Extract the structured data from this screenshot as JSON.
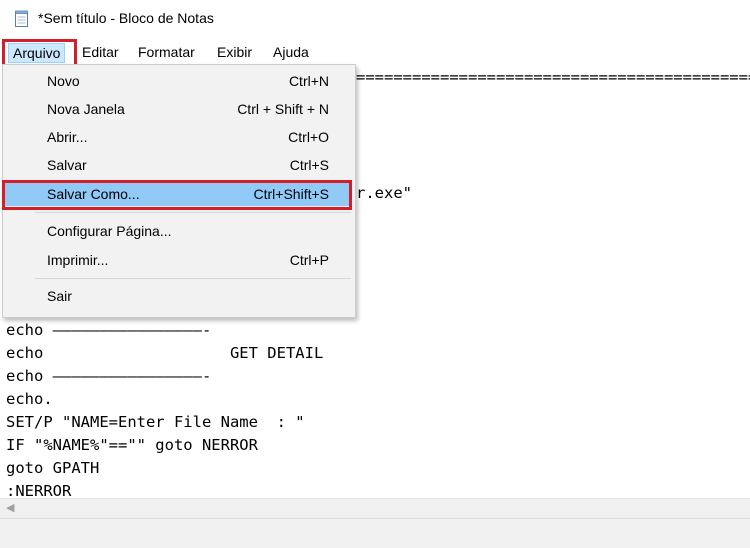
{
  "window": {
    "title": "*Sem título - Bloco de Notas"
  },
  "menubar": {
    "items": [
      "Arquivo",
      "Editar",
      "Formatar",
      "Exibir",
      "Ajuda"
    ]
  },
  "file_menu": {
    "items": [
      {
        "label": "Novo",
        "shortcut": "Ctrl+N"
      },
      {
        "label": "Nova Janela",
        "shortcut": "Ctrl + Shift + N"
      },
      {
        "label": "Abrir...",
        "shortcut": "Ctrl+O"
      },
      {
        "label": "Salvar",
        "shortcut": "Ctrl+S"
      },
      {
        "label": "Salvar Como...",
        "shortcut": "Ctrl+Shift+S"
      },
      {
        "label": "Configurar Página...",
        "shortcut": ""
      },
      {
        "label": "Imprimir...",
        "shortcut": "Ctrl+P"
      },
      {
        "label": "Sair",
        "shortcut": ""
      }
    ],
    "selected": "Salvar Como..."
  },
  "editor": {
    "lines": [
      "=============================================",
      "r.exe\"",
      "echo ————————————————-",
      "echo                    GET DETAIL",
      "echo ————————————————-",
      "echo.",
      "SET/P \"NAME=Enter File Name  : \"",
      "IF \"%NAME%\"==\"\" goto NERROR",
      "goto GPATH",
      ":NERROR"
    ]
  },
  "colors": {
    "highlight_border": "#d21f2a",
    "selected_item": "#91c9f7",
    "menu_bg": "#f2f2f2"
  }
}
